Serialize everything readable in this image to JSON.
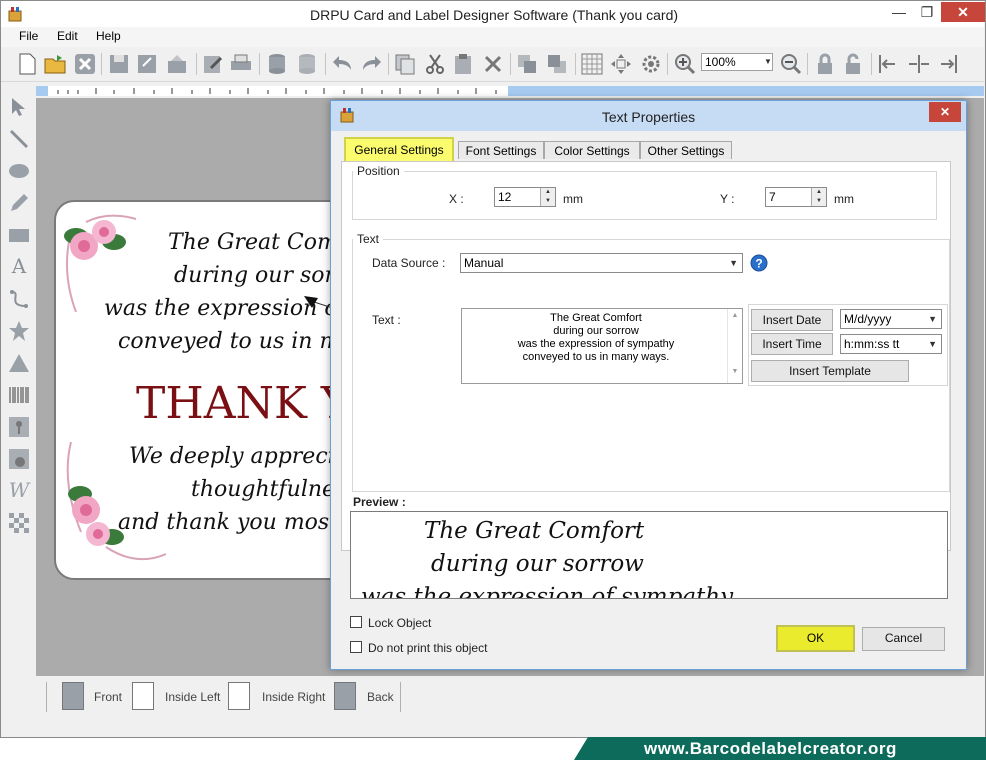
{
  "window": {
    "title": "DRPU Card and Label Designer Software  (Thank you card)"
  },
  "menu": [
    "File",
    "Edit",
    "Help"
  ],
  "toolbar": {
    "zoom": "100%"
  },
  "card": {
    "line1": "The Great Comfort",
    "line2": "during our sorrow",
    "line3": "was the expression of sympathy",
    "line4": "conveyed to us in many ways.",
    "thanks": "THANK YOU",
    "line5": "We deeply appreciate your",
    "line6": "thoughtfulness",
    "line7": "and thank you most sincerely"
  },
  "pages": [
    "Front",
    "Inside Left",
    "Inside Right",
    "Back"
  ],
  "dialog": {
    "title": "Text Properties",
    "tabs": [
      "General Settings",
      "Font Settings",
      "Color Settings",
      "Other Settings"
    ],
    "position_label": "Position",
    "x_label": "X :",
    "x_value": "12",
    "y_label": "Y :",
    "y_value": "7",
    "unit": "mm",
    "text_group_label": "Text",
    "data_source_label": "Data Source :",
    "data_source_value": "Manual",
    "text_label": "Text :",
    "text_lines": [
      "The Great Comfort",
      "during our sorrow",
      "was the expression of sympathy",
      "conveyed to us in many ways."
    ],
    "insert_date": "Insert Date",
    "date_format": "M/d/yyyy",
    "insert_time": "Insert Time",
    "time_format": "h:mm:ss tt",
    "insert_template": "Insert Template",
    "preview_label": "Preview :",
    "preview_lines": [
      "The Great Comfort",
      "during our sorrow",
      "was the expression of sympathy"
    ],
    "lock_object": "Lock Object",
    "no_print": "Do not print this object",
    "ok": "OK",
    "cancel": "Cancel"
  },
  "watermark": "www.Barcodelabelcreator.org",
  "colors": {
    "accent": "#fbfb6e",
    "dialog_title": "#c6dcf4",
    "thanks_text": "#7a0f14",
    "watermark_bg": "#0d6b5b"
  }
}
